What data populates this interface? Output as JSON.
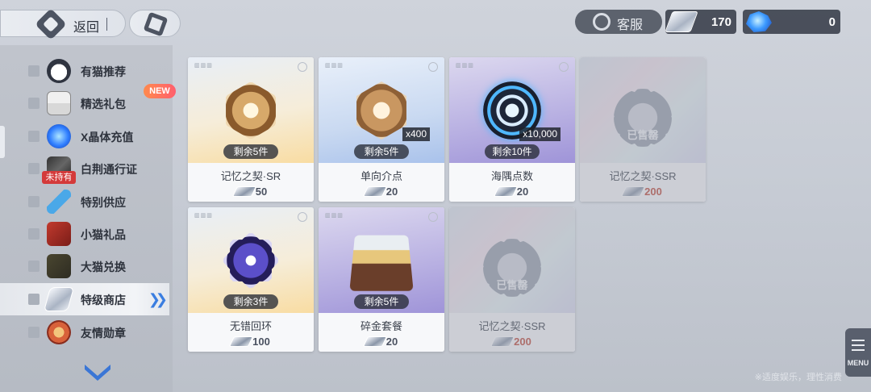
{
  "topbar": {
    "back_label": "返回",
    "customer_service_label": "客服",
    "currency_chip": {
      "icon": "chip-currency-icon",
      "amount": "170"
    },
    "currency_x": {
      "icon": "x-crystal-icon",
      "amount": "0"
    }
  },
  "sidebar": {
    "items": [
      {
        "label": "有猫推荐",
        "icon": "cat-icon"
      },
      {
        "label": "精选礼包",
        "icon": "gift-pack-icon",
        "badge": "NEW"
      },
      {
        "label": "X晶体充值",
        "icon": "x-crystal-icon"
      },
      {
        "label": "白荆通行证",
        "icon": "pass-icon",
        "badge": "未持有"
      },
      {
        "label": "特别供应",
        "icon": "vial-icon"
      },
      {
        "label": "小猫礼品",
        "icon": "card-icon"
      },
      {
        "label": "大猫兑换",
        "icon": "photo-icon"
      },
      {
        "label": "特级商店",
        "icon": "chip-currency-icon",
        "active": true
      },
      {
        "label": "友情勋章",
        "icon": "medal-icon"
      }
    ]
  },
  "products": [
    {
      "name": "记忆之契·SR",
      "price": "50",
      "stock": "剩余5件",
      "sold": false
    },
    {
      "name": "单向介点",
      "price": "20",
      "stock": "剩余5件",
      "qty": "x400",
      "sold": false
    },
    {
      "name": "海隅点数",
      "price": "20",
      "stock": "剩余10件",
      "qty": "x10,000",
      "sold": false
    },
    {
      "name": "记忆之契·SSR",
      "price": "200",
      "sold": true,
      "sold_label": "已售罄"
    },
    {
      "name": "无错回环",
      "price": "100",
      "stock": "剩余3件",
      "sold": false
    },
    {
      "name": "碎金套餐",
      "price": "20",
      "stock": "剩余5件",
      "sold": false
    },
    {
      "name": "记忆之契·SSR",
      "price": "200",
      "sold": true,
      "sold_label": "已售罄"
    }
  ],
  "menu_label": "MENU",
  "footer_note": "※适度娱乐，理性消费",
  "colors": {
    "accent": "#3b7ee0",
    "sold_price": "#c04a3a",
    "new_badge": "#ff6a5a"
  }
}
